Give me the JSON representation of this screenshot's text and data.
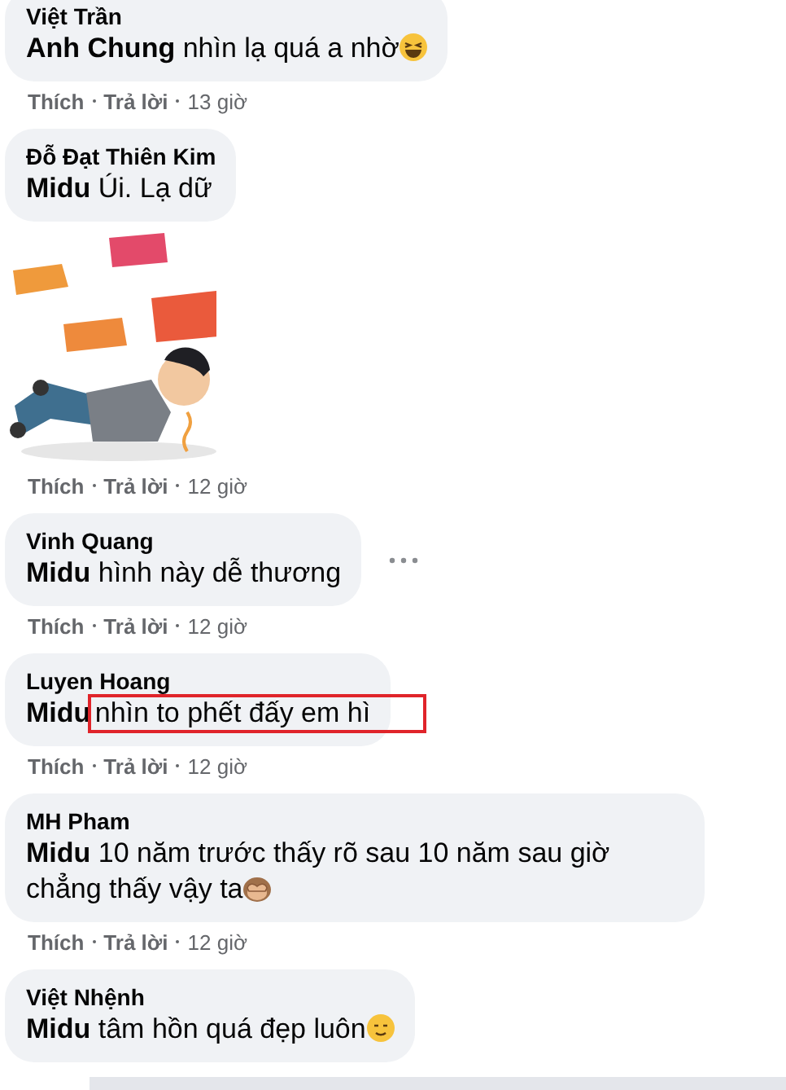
{
  "comments": [
    {
      "kind": "text",
      "author": "Việt Trần",
      "mention": "Anh Chung",
      "text": "nhìn lạ quá a nhờ",
      "emoji": {
        "kind": "laugh"
      },
      "highlighted": false,
      "more_menu": false,
      "actions": [
        "Thích",
        "Trả lời"
      ],
      "time": "13 giờ"
    },
    {
      "kind": "text",
      "author": "Đỗ Đạt Thiên Kim",
      "mention": "Midu",
      "text": "Úi. Lạ dữ",
      "highlighted": false,
      "more_menu": false
    },
    {
      "kind": "sticker",
      "actions": [
        "Thích",
        "Trả lời"
      ],
      "time": "12 giờ"
    },
    {
      "kind": "text",
      "author": "Vinh Quang",
      "mention": "Midu",
      "text": "hình này dễ thương",
      "highlighted": false,
      "more_menu": true,
      "actions": [
        "Thích",
        "Trả lời"
      ],
      "time": "12 giờ"
    },
    {
      "kind": "text",
      "author": "Luyen Hoang",
      "mention": "Midu",
      "text": "nhìn to phết đấy em hì",
      "highlighted": true,
      "more_menu": false,
      "actions": [
        "Thích",
        "Trả lời"
      ],
      "time": "12 giờ"
    },
    {
      "kind": "text",
      "author": "MH Pham",
      "mention": "Midu",
      "text": "10 năm trước thấy rõ sau 10 năm sau giờ chẳng thấy vậy ta",
      "emoji": {
        "kind": "monkey"
      },
      "highlighted": false,
      "more_menu": false,
      "actions": [
        "Thích",
        "Trả lời"
      ],
      "time": "12 giờ"
    },
    {
      "kind": "text",
      "author": "Việt Nhệnh",
      "mention": "Midu",
      "text": "tâm hồn quá đẹp luôn",
      "emoji": {
        "kind": "smile"
      },
      "highlighted": false,
      "more_menu": false
    }
  ]
}
